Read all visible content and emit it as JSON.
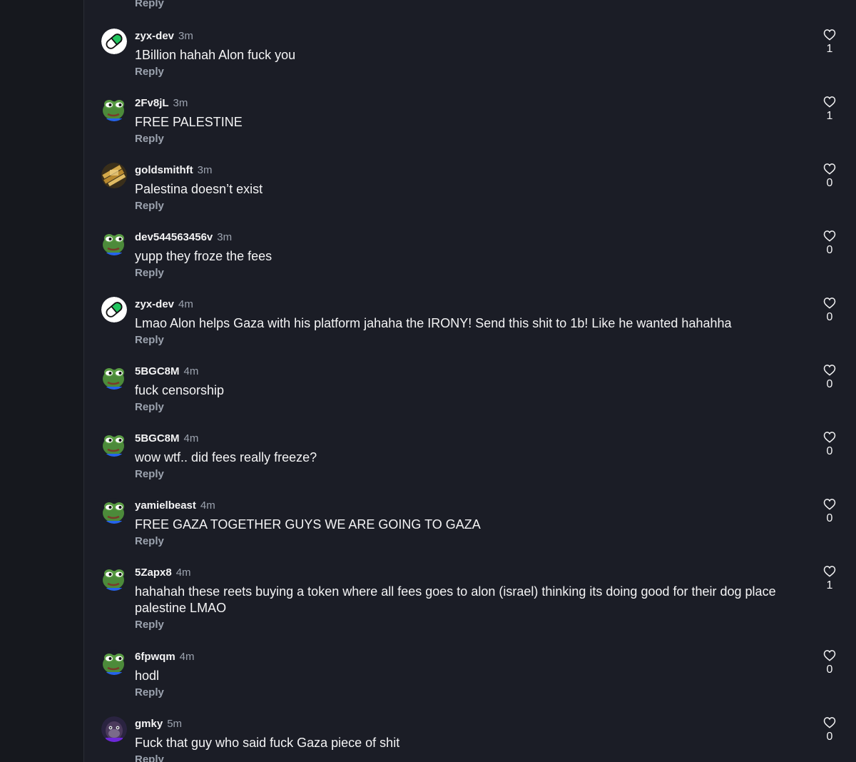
{
  "top_reply_label": "Reply",
  "colors": {
    "background": "#1b1d26",
    "sidebar": "#16181e",
    "muted_text": "#9ca3af",
    "pill_green": "#22c55e"
  },
  "comments": [
    {
      "user": "zyx-dev",
      "time": "3m",
      "text": "1Billion hahah Alon fuck you",
      "reply": "Reply",
      "likes": "1",
      "avatar": "green-pill"
    },
    {
      "user": "2Fv8jL",
      "time": "3m",
      "text": "FREE PALESTINE",
      "reply": "Reply",
      "likes": "1",
      "avatar": "frog"
    },
    {
      "user": "goldsmithft",
      "time": "3m",
      "text": "Palestina doesn’t exist",
      "reply": "Reply",
      "likes": "0",
      "avatar": "gold-bars"
    },
    {
      "user": "dev544563456v",
      "time": "3m",
      "text": "yupp they froze the fees",
      "reply": "Reply",
      "likes": "0",
      "avatar": "frog"
    },
    {
      "user": "zyx-dev",
      "time": "4m",
      "text": "Lmao Alon helps Gaza with his platform jahaha the IRONY! Send this shit to 1b! Like he wanted hahahha",
      "reply": "Reply",
      "likes": "0",
      "avatar": "green-pill"
    },
    {
      "user": "5BGC8M",
      "time": "4m",
      "text": "fuck censorship",
      "reply": "Reply",
      "likes": "0",
      "avatar": "frog"
    },
    {
      "user": "5BGC8M",
      "time": "4m",
      "text": "wow wtf.. did fees really freeze?",
      "reply": "Reply",
      "likes": "0",
      "avatar": "frog"
    },
    {
      "user": "yamielbeast",
      "time": "4m",
      "text": "FREE GAZA TOGETHER GUYS WE ARE GOING TO GAZA",
      "reply": "Reply",
      "likes": "0",
      "avatar": "frog"
    },
    {
      "user": "5Zapx8",
      "time": "4m",
      "text": "hahahah these reets buying a token where all fees goes to alon (israel) thinking its doing good for their dog place palestine LMAO",
      "reply": "Reply",
      "likes": "1",
      "avatar": "frog"
    },
    {
      "user": "6fpwqm",
      "time": "4m",
      "text": "hodl",
      "reply": "Reply",
      "likes": "0",
      "avatar": "frog"
    },
    {
      "user": "gmky",
      "time": "5m",
      "text": "Fuck that guy who said fuck Gaza piece of shit",
      "reply": "Reply",
      "likes": "0",
      "avatar": "ape"
    }
  ]
}
